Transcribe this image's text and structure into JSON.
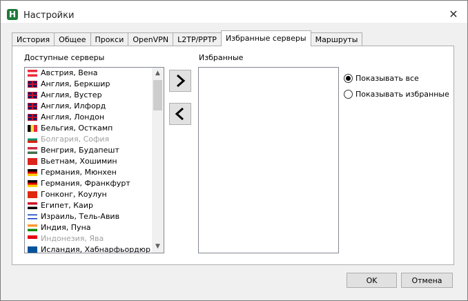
{
  "window": {
    "title": "Настройки",
    "app_icon_letter": "H",
    "close_glyph": "✕"
  },
  "tabs": [
    {
      "label": "История",
      "active": false
    },
    {
      "label": "Общее",
      "active": false
    },
    {
      "label": "Прокси",
      "active": false
    },
    {
      "label": "OpenVPN",
      "active": false
    },
    {
      "label": "L2TP/PPTP",
      "active": false
    },
    {
      "label": "Избранные серверы",
      "active": true
    },
    {
      "label": "Маршруты",
      "active": false
    }
  ],
  "available": {
    "label": "Доступные серверы",
    "items": [
      {
        "label": "Австрия, Вена",
        "flag": "austria",
        "disabled": false
      },
      {
        "label": "Англия, Беркшир",
        "flag": "uk",
        "disabled": false
      },
      {
        "label": "Англия, Вустер",
        "flag": "uk",
        "disabled": false
      },
      {
        "label": "Англия, Илфорд",
        "flag": "uk",
        "disabled": false
      },
      {
        "label": "Англия, Лондон",
        "flag": "uk",
        "disabled": false
      },
      {
        "label": "Бельгия, Осткамп",
        "flag": "belgium",
        "disabled": false
      },
      {
        "label": "Болгария, София",
        "flag": "bulgaria",
        "disabled": true
      },
      {
        "label": "Венгрия, Будапешт",
        "flag": "hungary",
        "disabled": false
      },
      {
        "label": "Вьетнам, Хошимин",
        "flag": "vietnam",
        "disabled": false
      },
      {
        "label": "Германия, Мюнхен",
        "flag": "germany",
        "disabled": false
      },
      {
        "label": "Германия, Франкфурт",
        "flag": "germany",
        "disabled": false
      },
      {
        "label": "Гонконг, Коулун",
        "flag": "hongkong",
        "disabled": false
      },
      {
        "label": "Египет, Каир",
        "flag": "egypt",
        "disabled": false
      },
      {
        "label": "Израиль, Тель-Авив",
        "flag": "israel",
        "disabled": false
      },
      {
        "label": "Индия, Пуна",
        "flag": "india",
        "disabled": false
      },
      {
        "label": "Индонезия, Ява",
        "flag": "indonesia",
        "disabled": true
      },
      {
        "label": "Исландия, Хабнарфьордюр",
        "flag": "iceland",
        "disabled": false
      }
    ]
  },
  "favorites": {
    "label": "Избранные"
  },
  "move": {
    "add_icon": "chevron-right-icon",
    "remove_icon": "chevron-left-icon"
  },
  "display": {
    "options": [
      {
        "label": "Показывать все",
        "checked": true
      },
      {
        "label": "Показывать избранные",
        "checked": false
      }
    ]
  },
  "footer": {
    "ok_label": "OK",
    "cancel_label": "Отмена"
  },
  "colors": {
    "app_icon": "#1f7a3a",
    "panel": "#ffffff",
    "window": "#f0f0f0"
  }
}
